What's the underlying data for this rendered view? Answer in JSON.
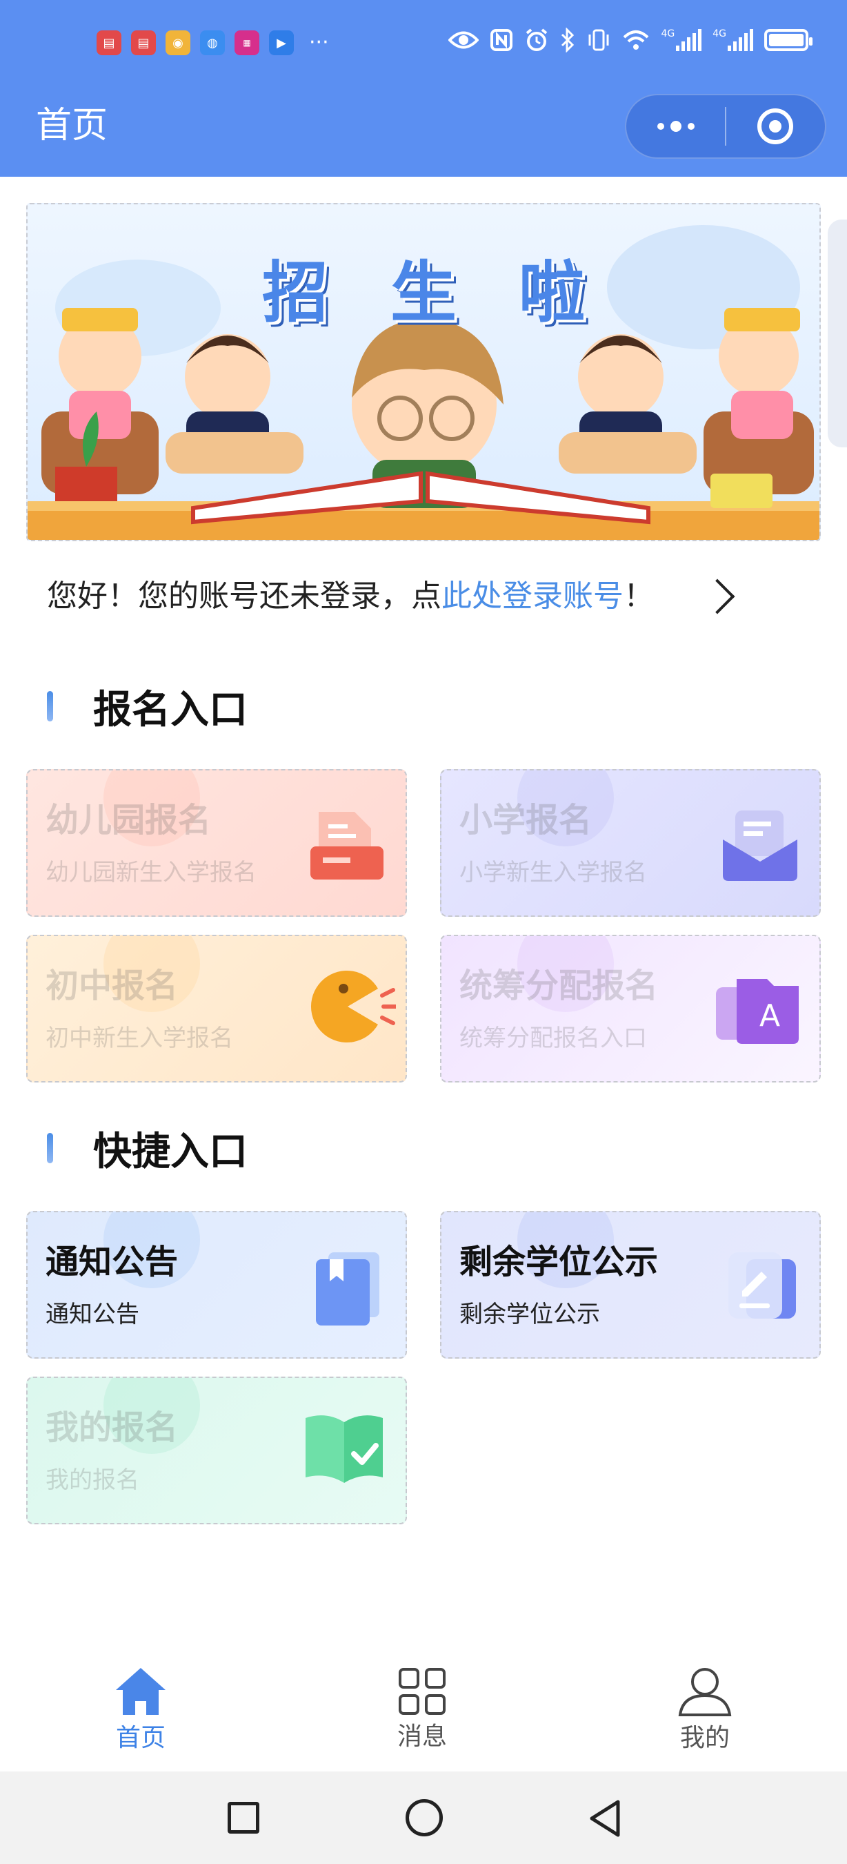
{
  "status_bar": {
    "left_app_icons": [
      "reader-icon",
      "reader-icon",
      "weibo-icon",
      "browser-icon",
      "magazine-icon",
      "video-icon"
    ],
    "more": "···",
    "net_label_1": "4G",
    "net_label_2": "4G"
  },
  "nav": {
    "title": "首页"
  },
  "banner": {
    "headline": "招生啦"
  },
  "login": {
    "prefix": "您好！您的账号还未登录，点",
    "link": "此处登录账号",
    "suffix": "！"
  },
  "sections": {
    "registration": "报名入口",
    "shortcuts": "快捷入口"
  },
  "registration_cards": [
    {
      "title": "幼儿园报名",
      "subtitle": "幼儿园新生入学报名"
    },
    {
      "title": "小学报名",
      "subtitle": "小学新生入学报名"
    },
    {
      "title": "初中报名",
      "subtitle": "初中新生入学报名"
    },
    {
      "title": "统筹分配报名",
      "subtitle": "统筹分配报名入口"
    }
  ],
  "shortcut_cards": [
    {
      "title": "通知公告",
      "subtitle": "通知公告"
    },
    {
      "title": "剩余学位公示",
      "subtitle": "剩余学位公示"
    },
    {
      "title": "我的报名",
      "subtitle": "我的报名"
    }
  ],
  "tabbar": [
    {
      "label": "首页",
      "icon": "home-icon",
      "active": true
    },
    {
      "label": "消息",
      "icon": "grid-icon",
      "active": false
    },
    {
      "label": "我的",
      "icon": "user-icon",
      "active": false
    }
  ],
  "colors": {
    "primary": "#5b8ff2",
    "link": "#4a8de6",
    "tab_active": "#3d82e6"
  }
}
